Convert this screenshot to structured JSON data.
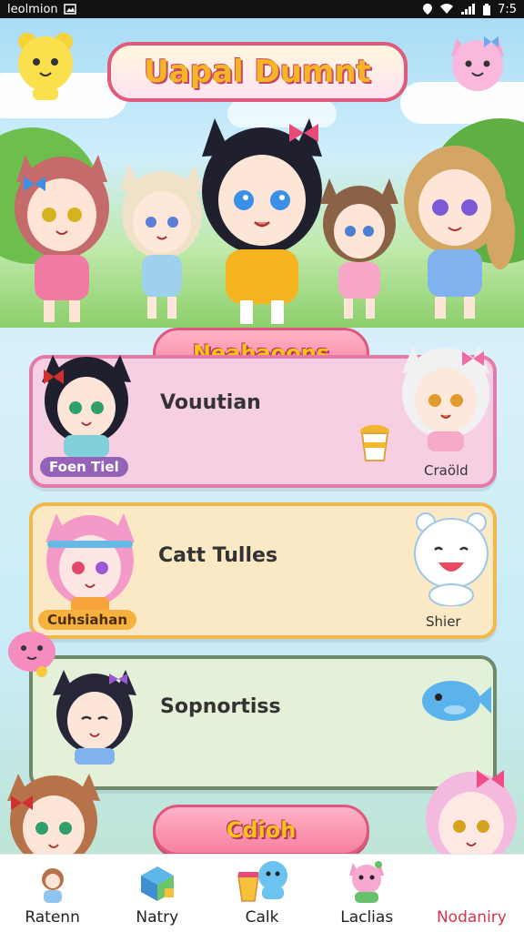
{
  "status_bar": {
    "carrier": "leolmion",
    "time": "7:5"
  },
  "hero": {
    "title": "Uapal Dumnt"
  },
  "sections": {
    "top_banner": "Neahaoons",
    "bottom_banner": "Cdioh"
  },
  "cards": [
    {
      "title": "Vouutian",
      "left_tag": "Foen Tiel",
      "right_tag": "Craöld",
      "bg": "#f6cfe2",
      "border": "#e47aa8"
    },
    {
      "title": "Catt Tulles",
      "left_tag": "Cuhsiahan",
      "right_tag": "Shier",
      "bg": "#fbe8c4",
      "border": "#f1b94d"
    },
    {
      "title": "Sopnortiss",
      "left_tag": "",
      "right_tag": "",
      "bg": "#e4f1d9",
      "border": "#6f8a6b"
    }
  ],
  "bottom_nav": [
    {
      "label": "Ratenn",
      "icon": "character-icon",
      "active": false
    },
    {
      "label": "Natry",
      "icon": "gift-box-icon",
      "active": false
    },
    {
      "label": "Calk",
      "icon": "cup-mascot-icon",
      "active": false
    },
    {
      "label": "Laclias",
      "icon": "pet-icon",
      "active": false
    },
    {
      "label": "Nodaniry",
      "icon": "girl-icon",
      "active": true
    }
  ],
  "colors": {
    "accent_pink": "#f77fa0",
    "title_yellow": "#f4b623",
    "active_nav": "#d8344f"
  }
}
